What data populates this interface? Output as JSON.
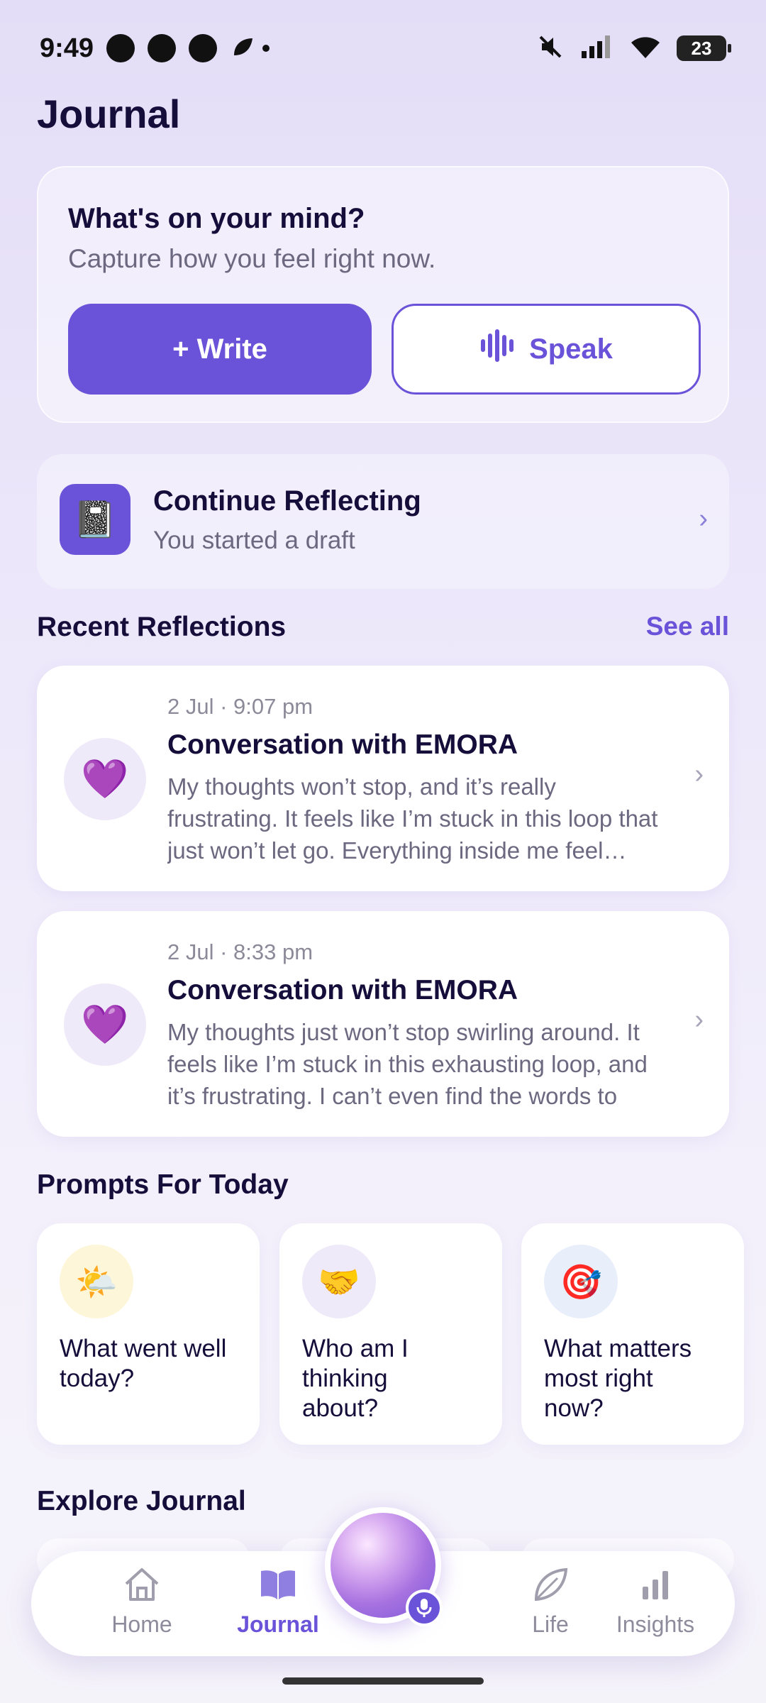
{
  "status_bar": {
    "time": "9:49",
    "battery": "23"
  },
  "page": {
    "title": "Journal"
  },
  "mind_card": {
    "title": "What's on your mind?",
    "subtitle": "Capture how you feel right now.",
    "write_label": "+ Write",
    "speak_label": "Speak"
  },
  "continue": {
    "title": "Continue Reflecting",
    "subtitle": "You started a draft",
    "icon": "notebook-icon"
  },
  "recent": {
    "header": "Recent Reflections",
    "see_all": "See all",
    "items": [
      {
        "date": "2 Jul · 9:07 pm",
        "title": "Conversation with EMORA",
        "excerpt": "My thoughts won’t stop, and it’s really frustrating. It feels like I’m stuck in this loop that just won’t let go. Everything inside me feel…",
        "icon": "purple-heart-icon"
      },
      {
        "date": "2 Jul · 8:33 pm",
        "title": "Conversation with EMORA",
        "excerpt": "My thoughts just won’t stop swirling around. It feels like I’m stuck in this exhausting loop, and it’s frustrating. I can’t even find the words to ex…",
        "icon": "purple-heart-icon"
      }
    ]
  },
  "prompts": {
    "header": "Prompts For Today",
    "items": [
      {
        "text": "What went well today?",
        "icon": "sun-behind-cloud-icon",
        "bg": "#fdf6d8"
      },
      {
        "text": "Who am I thinking about?",
        "icon": "handshake-icon",
        "bg": "#efeaf9"
      },
      {
        "text": "What matters most right now?",
        "icon": "target-icon",
        "bg": "#e9eefb"
      }
    ]
  },
  "explore": {
    "header": "Explore Journal"
  },
  "nav": {
    "items": [
      {
        "label": "Home",
        "icon": "home-icon"
      },
      {
        "label": "Journal",
        "icon": "book-icon",
        "active": true
      },
      {
        "label": "Life",
        "icon": "leaf-icon"
      },
      {
        "label": "Insights",
        "icon": "bar-chart-icon"
      }
    ]
  },
  "colors": {
    "accent": "#6a52d9",
    "title": "#150d3a",
    "muted": "#6b6880"
  }
}
